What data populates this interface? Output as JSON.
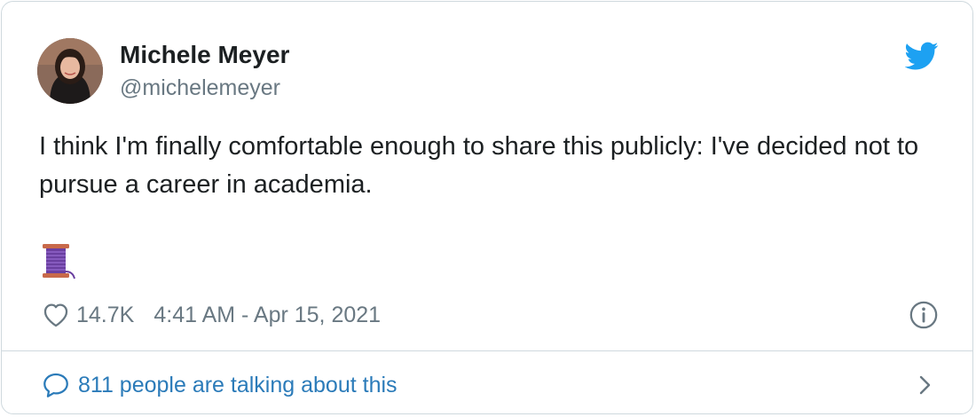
{
  "tweet": {
    "author": {
      "name": "Michele Meyer",
      "handle": "@michelemeyer",
      "avatar_icon": "profile-photo"
    },
    "text": "I think I'm finally comfortable enough to share this publicly: I've decided not to pursue a career in academia.",
    "emoji": "🧵",
    "emoji_icon": "thread-spool-icon",
    "likes": "14.7K",
    "timestamp": "4:41 AM - Apr 15, 2021",
    "footer_text": "811 people are talking about this"
  },
  "colors": {
    "twitter_blue": "#1da1f2",
    "link_blue": "#2b7bb9",
    "muted_gray": "#697882",
    "border": "#cfd9de",
    "spool_purple": "#6a3fa0",
    "spool_wood": "#c8694a"
  },
  "icons": {
    "brand": "twitter-bird-icon",
    "like": "heart-icon",
    "info": "info-icon",
    "reply": "speech-bubble-icon",
    "more": "chevron-right-icon"
  }
}
